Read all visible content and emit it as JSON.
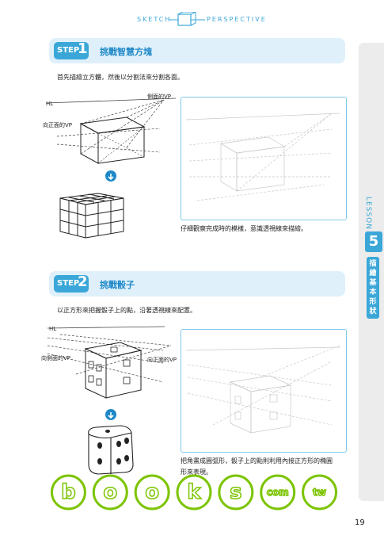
{
  "header": {
    "left": "SKETCH",
    "right": "PERSPECTIVE"
  },
  "sidebar": {
    "lesson": "LESSON",
    "number": "5",
    "label": "描繪基本形狀"
  },
  "step1": {
    "badge": "STEP",
    "number": "1",
    "title": "挑戰智慧方塊",
    "intro": "首先描繪立方體，然後以分割法來分割各面。",
    "labels": {
      "hl": "HL",
      "vp_side": "側面的VP",
      "vp_front": "向正面的VP"
    },
    "caption": "仔細觀察完成時的模樣，意識透視線來描繪。"
  },
  "step2": {
    "badge": "STEP",
    "number": "2",
    "title": "挑戰骰子",
    "intro": "以正方形來把握骰子上的點，沿著透視線來配置。",
    "labels": {
      "hl": "HL",
      "vp_side": "向側面的VP",
      "vp_front": "向正面的VP"
    },
    "caption_line1": "把角畫成圓弧形，骰子上的點則利用內接正方形的橢圓",
    "caption_line2": "形來表現。"
  },
  "watermark": {
    "letters": [
      "b",
      "o",
      "o",
      "k",
      "s",
      "com",
      "tw"
    ]
  },
  "page": {
    "number": "19"
  },
  "colors": {
    "accent": "#3aa7d8",
    "accent_dark": "#1e88c8",
    "light_bar": "#dff0fa",
    "watermark_green": "#7cc400"
  }
}
